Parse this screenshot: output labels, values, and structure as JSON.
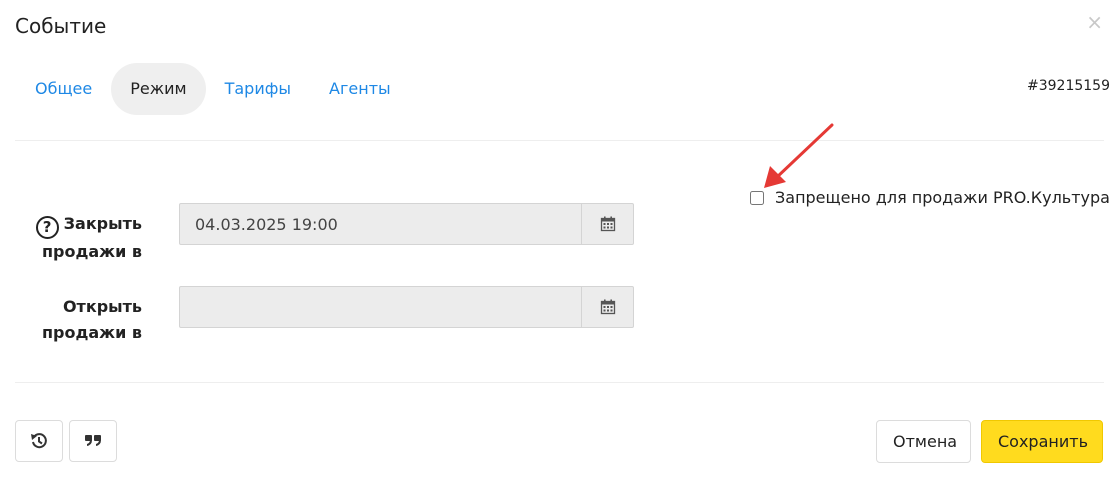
{
  "dialog": {
    "title": "Событие",
    "close_symbol": "×",
    "event_id": "#39215159"
  },
  "tabs": [
    {
      "label": "Общее",
      "active": false
    },
    {
      "label": "Режим",
      "active": true
    },
    {
      "label": "Тарифы",
      "active": false
    },
    {
      "label": "Агенты",
      "active": false
    }
  ],
  "form": {
    "close_sales": {
      "label_line1": "Закрыть",
      "label_line2": "продажи в",
      "value": "04.03.2025 19:00",
      "help_icon": "question-circle-icon"
    },
    "open_sales": {
      "label_line1": "Открыть",
      "label_line2": "продажи в",
      "value": ""
    },
    "prohibited_checkbox": {
      "label": "Запрещено для продажи PRO.Культура",
      "checked": false
    },
    "calendar_icon": "calendar-icon"
  },
  "annotation": {
    "color": "#e53935",
    "icon": "red-arrow-annotation"
  },
  "footer": {
    "history_icon": "history-icon",
    "quote_icon": "quote-icon",
    "cancel_label": "Отмена",
    "save_label": "Сохранить",
    "save_color": "#ffdb1e"
  }
}
